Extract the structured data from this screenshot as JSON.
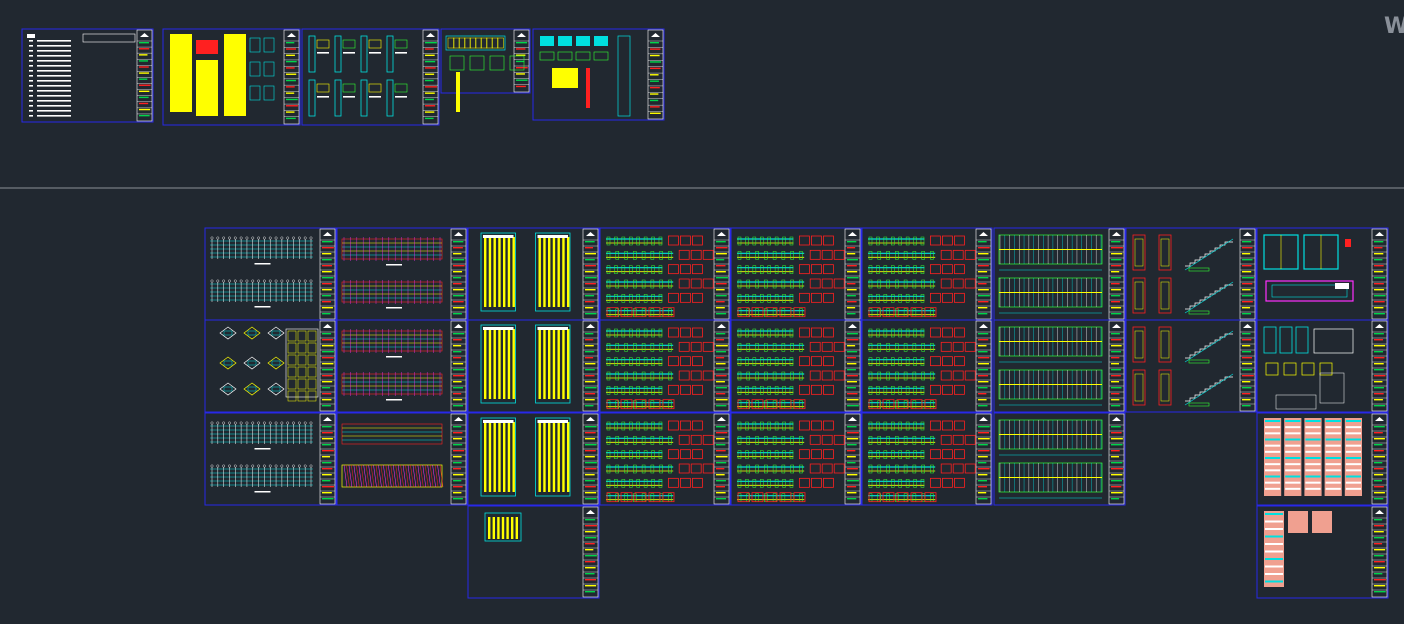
{
  "viewport": {
    "background": "#212830",
    "corner_text": "W"
  },
  "colors": {
    "sheet_border": "#2828e8",
    "title_block_line": "#ffffff",
    "title_block_accent": "#00d44a",
    "yellow": "#ffff00",
    "cyan": "#00e0e0",
    "red": "#ff2020",
    "green": "#30ff30",
    "magenta": "#ff30ff",
    "salmon": "#f0a090",
    "white": "#ffffff",
    "layout_divider": "#8a8f96"
  }
}
